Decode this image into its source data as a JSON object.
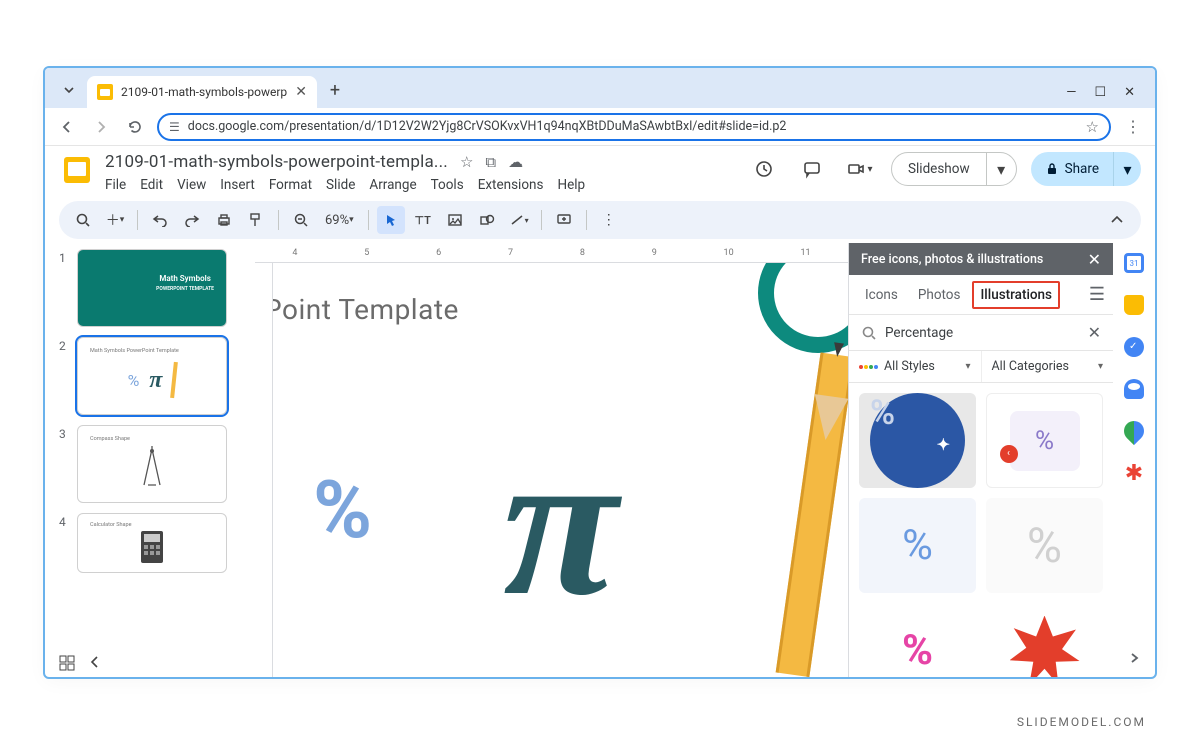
{
  "browser": {
    "tab_title": "2109-01-math-symbols-powerp",
    "url": "docs.google.com/presentation/d/1D12V2W2Yjg8CrVSOKvxVH1q94nqXBtDDuMaSAwbtBxl/edit#slide=id.p2"
  },
  "doc": {
    "title": "2109-01-math-symbols-powerpoint-templa...",
    "menus": [
      "File",
      "Edit",
      "View",
      "Insert",
      "Format",
      "Slide",
      "Arrange",
      "Tools",
      "Extensions",
      "Help"
    ]
  },
  "toolbar": {
    "zoom": "69%"
  },
  "actions": {
    "slideshow": "Slideshow",
    "share": "Share"
  },
  "slides": [
    {
      "num": "1",
      "label": "Math Symbols",
      "sub": "POWERPOINT TEMPLATE"
    },
    {
      "num": "2",
      "label": "Math Symbols PowerPoint Template"
    },
    {
      "num": "3",
      "label": "Compass Shape"
    },
    {
      "num": "4",
      "label": "Calculator Shape"
    }
  ],
  "ruler_marks": [
    "4",
    "5",
    "6",
    "7",
    "8",
    "9",
    "10",
    "11"
  ],
  "canvas": {
    "title_fragment": "ls PowerPoint Template",
    "pi": "π",
    "percent": "%"
  },
  "panel": {
    "title": "Free icons, photos & illustrations",
    "tabs": [
      "Icons",
      "Photos",
      "Illustrations"
    ],
    "active_tab": 2,
    "search_value": "Percentage",
    "filter_style": "All Styles",
    "filter_cat": "All Categories"
  },
  "brand": "SLIDEMODEL.COM"
}
